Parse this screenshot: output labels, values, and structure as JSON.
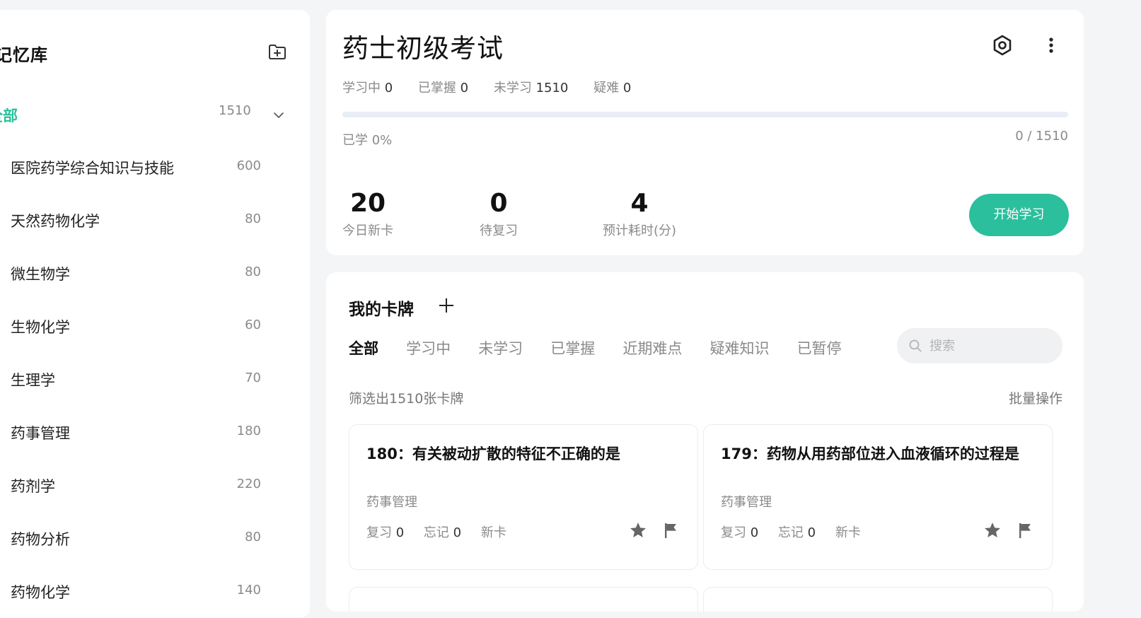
{
  "sidebar": {
    "title": "记忆库",
    "all": {
      "label": "全部",
      "count": "1510"
    },
    "items": [
      {
        "label": "医院药学综合知识与技能",
        "count": "600"
      },
      {
        "label": "天然药物化学",
        "count": "80"
      },
      {
        "label": "微生物学",
        "count": "80"
      },
      {
        "label": "生物化学",
        "count": "60"
      },
      {
        "label": "生理学",
        "count": "70"
      },
      {
        "label": "药事管理",
        "count": "180"
      },
      {
        "label": "药剂学",
        "count": "220"
      },
      {
        "label": "药物分析",
        "count": "80"
      },
      {
        "label": "药物化学",
        "count": "140"
      }
    ]
  },
  "deck": {
    "title": "药士初级考试",
    "stats": [
      {
        "label": "学习中",
        "value": "0"
      },
      {
        "label": "已掌握",
        "value": "0"
      },
      {
        "label": "未学习",
        "value": "1510"
      },
      {
        "label": "疑难",
        "value": "0"
      }
    ],
    "progress_fraction": 0,
    "progress_label": "已学 0%",
    "progress_count": "0 / 1510",
    "metrics": [
      {
        "value": "20",
        "label": "今日新卡"
      },
      {
        "value": "0",
        "label": "待复习"
      },
      {
        "value": "4",
        "label": "预计耗时(分)"
      }
    ],
    "start_label": "开始学习"
  },
  "cards_section": {
    "title": "我的卡牌",
    "tabs": [
      "全部",
      "学习中",
      "未学习",
      "已掌握",
      "近期难点",
      "疑难知识",
      "已暂停"
    ],
    "active_tab": "全部",
    "search_placeholder": "搜索",
    "filter_count": "筛选出1510张卡牌",
    "batch_label": "批量操作",
    "cards": [
      {
        "question": "180：有关被动扩散的特征不正确的是",
        "tag": "药事管理",
        "review_label": "复习",
        "review": "0",
        "forget_label": "忘记",
        "forget": "0",
        "status": "新卡"
      },
      {
        "question": "179：药物从用药部位进入血液循环的过程是",
        "tag": "药事管理",
        "review_label": "复习",
        "review": "0",
        "forget_label": "忘记",
        "forget": "0",
        "status": "新卡"
      }
    ]
  },
  "colors": {
    "accent": "#2bbf9d",
    "muted_text": "#8a8a8a",
    "icon_gray": "#666666"
  },
  "icons": {
    "add_folder": "folder-plus-icon",
    "chevron": "chevron-down-icon",
    "settings": "settings-icon",
    "more": "more-vertical-icon",
    "add_card": "plus-icon",
    "search": "search-icon",
    "star": "star-icon",
    "flag": "flag-icon"
  }
}
